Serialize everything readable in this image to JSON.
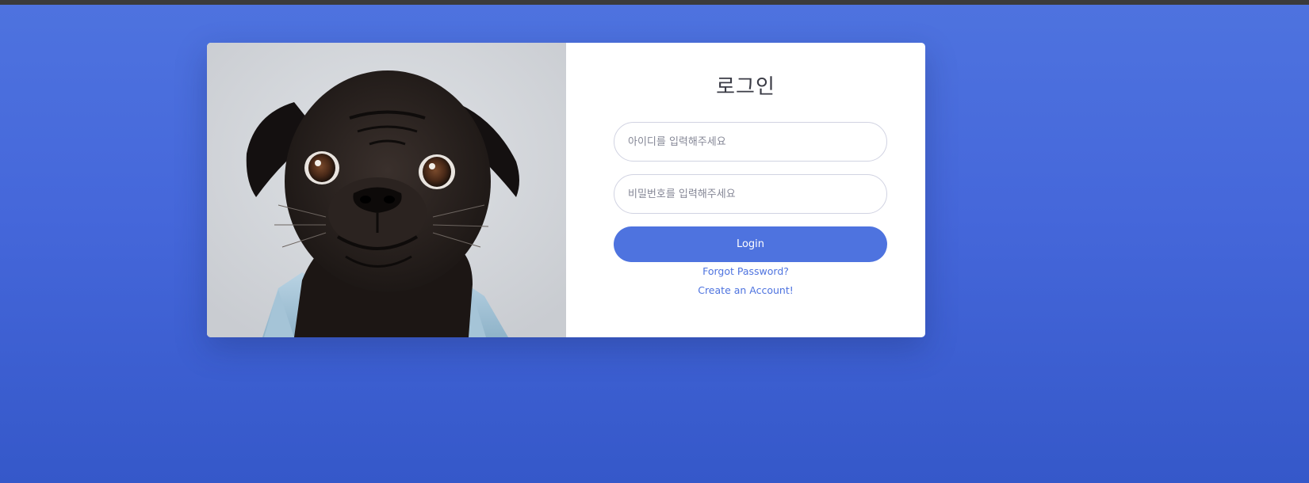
{
  "login": {
    "title": "로그인",
    "id_placeholder": "아이디를 입력해주세요",
    "password_placeholder": "비밀번호를 입력해주세요",
    "login_button": "Login",
    "forgot_password": "Forgot Password?",
    "create_account": "Create an Account!"
  },
  "colors": {
    "primary": "#4e73df",
    "background_top": "#4e73df",
    "background_bottom": "#3558c9",
    "card": "#ffffff",
    "topbar": "#3b3b3b"
  },
  "image": {
    "subject": "black pug wearing denim jacket"
  }
}
